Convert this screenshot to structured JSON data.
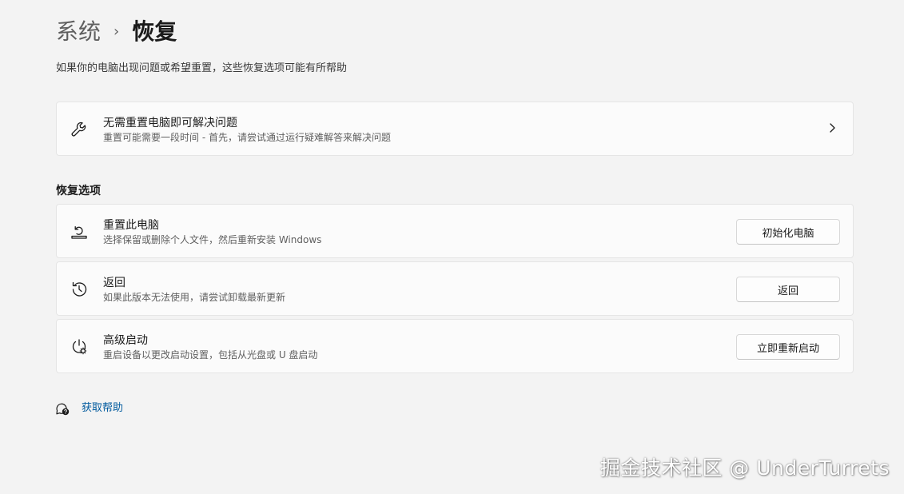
{
  "breadcrumb": {
    "parent": "系统",
    "separator": "›",
    "current": "恢复"
  },
  "page_description": "如果你的电脑出现问题或希望重置，这些恢复选项可能有所帮助",
  "troubleshoot_card": {
    "icon": "wrench-icon",
    "title": "无需重置电脑即可解决问题",
    "subtitle": "重置可能需要一段时间 - 首先，请尝试通过运行疑难解答来解决问题"
  },
  "recovery_section": {
    "heading": "恢复选项",
    "items": [
      {
        "icon": "reset-pc-icon",
        "title": "重置此电脑",
        "subtitle": "选择保留或删除个人文件，然后重新安装 Windows",
        "button_label": "初始化电脑"
      },
      {
        "icon": "history-icon",
        "title": "返回",
        "subtitle": "如果此版本无法使用，请尝试卸载最新更新",
        "button_label": "返回"
      },
      {
        "icon": "advanced-startup-icon",
        "title": "高级启动",
        "subtitle": "重启设备以更改启动设置，包括从光盘或 U 盘启动",
        "button_label": "立即重新启动"
      }
    ]
  },
  "help_link": {
    "icon": "help-icon",
    "label": "获取帮助"
  },
  "watermark": "掘金技术社区 @ UnderTurrets",
  "colors": {
    "background": "#f3f3f3",
    "card": "#fbfbfb",
    "link": "#005a9e"
  }
}
